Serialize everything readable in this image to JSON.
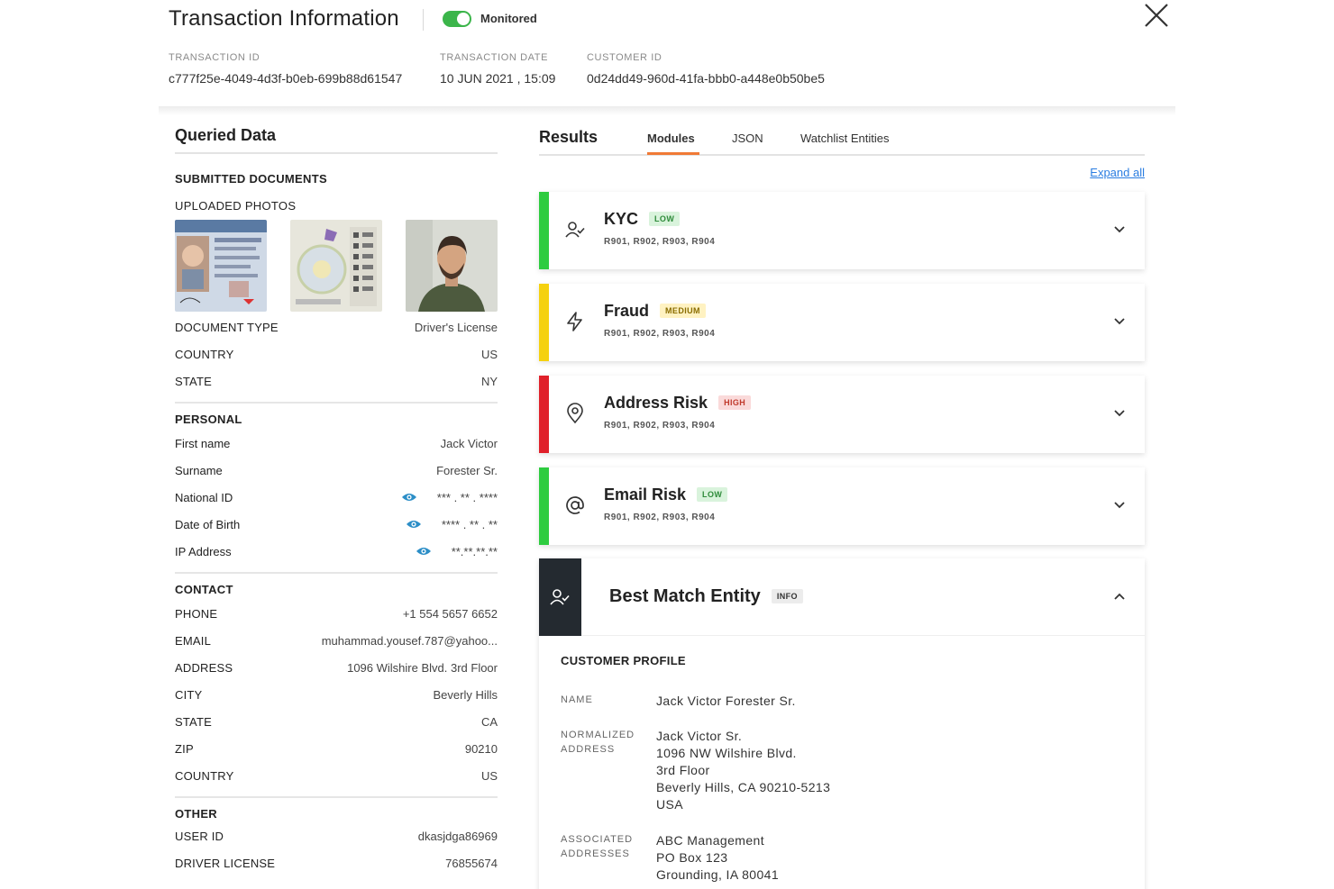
{
  "header": {
    "title": "Transaction Information",
    "monitored_label": "Monitored",
    "transaction_id_label": "TRANSACTION ID",
    "transaction_id": "c777f25e-4049-4d3f-b0eb-699b88d61547",
    "transaction_date_label": "TRANSACTION DATE",
    "transaction_date": "10 JUN 2021 , 15:09",
    "customer_id_label": "CUSTOMER ID",
    "customer_id": "0d24dd49-960d-41fa-bbb0-a448e0b50be5"
  },
  "queried": {
    "title": "Queried Data",
    "submitted_documents": "SUBMITTED DOCUMENTS",
    "uploaded_photos": "UPLOADED PHOTOS",
    "document_rows": [
      {
        "label": "DOCUMENT TYPE",
        "value": "Driver's License"
      },
      {
        "label": "COUNTRY",
        "value": "US"
      },
      {
        "label": "STATE",
        "value": "NY"
      }
    ],
    "personal_title": "PERSONAL",
    "personal_rows": [
      {
        "label": "First name",
        "value": "Jack Victor"
      },
      {
        "label": "Surname",
        "value": "Forester Sr."
      },
      {
        "label": "National ID",
        "value": "*** . ** . ****"
      },
      {
        "label": "Date of Birth",
        "value": "**** . ** . **"
      },
      {
        "label": "IP Address",
        "value": "**.**.**.**"
      }
    ],
    "contact_title": "CONTACT",
    "contact_rows": [
      {
        "label": "PHONE",
        "value": "+1 554 5657 6652"
      },
      {
        "label": "EMAIL",
        "value": "muhammad.yousef.787@yahoo..."
      },
      {
        "label": "ADDRESS",
        "value": "1096 Wilshire Blvd. 3rd Floor"
      },
      {
        "label": "CITY",
        "value": "Beverly Hills"
      },
      {
        "label": "STATE",
        "value": "CA"
      },
      {
        "label": "ZIP",
        "value": "90210"
      },
      {
        "label": "COUNTRY",
        "value": "US"
      }
    ],
    "other_title": "OTHER",
    "other_rows": [
      {
        "label": "USER ID",
        "value": "dkasjdga86969"
      },
      {
        "label": "DRIVER LICENSE",
        "value": "76855674"
      }
    ]
  },
  "results": {
    "title": "Results",
    "tabs": [
      "Modules",
      "JSON",
      "Watchlist Entities"
    ],
    "expand_all": "Expand all",
    "modules": [
      {
        "name": "KYC",
        "level": "LOW",
        "codes": "R901, R902, R903, R904",
        "color": "#2ecc40",
        "icon": "user-check-icon"
      },
      {
        "name": "Fraud",
        "level": "MEDIUM",
        "codes": "R901, R902, R903, R904",
        "color": "#f5d10f",
        "icon": "lightning-icon"
      },
      {
        "name": "Address Risk",
        "level": "HIGH",
        "codes": "R901, R902, R903, R904",
        "color": "#e0202a",
        "icon": "location-pin-icon"
      },
      {
        "name": "Email Risk",
        "level": "LOW",
        "codes": "R901, R902, R903, R904",
        "color": "#2ecc40",
        "icon": "at-sign-icon"
      }
    ],
    "best_match": {
      "name": "Best Match Entity",
      "level": "INFO",
      "profile_title": "CUSTOMER PROFILE",
      "name_label": "NAME",
      "name_value": "Jack Victor Forester Sr.",
      "norm_label_1": "NORMALIZED",
      "norm_label_2": "ADDRESS",
      "norm_lines": [
        "Jack Victor Sr.",
        "1096 NW Wilshire Blvd.",
        "3rd Floor",
        "Beverly Hills, CA 90210-5213",
        "USA"
      ],
      "assoc_label_1": "ASSOCIATED",
      "assoc_label_2": "ADDRESSES",
      "assoc_lines": [
        "ABC Management",
        "PO Box 123",
        "Grounding, IA 80041"
      ]
    }
  }
}
